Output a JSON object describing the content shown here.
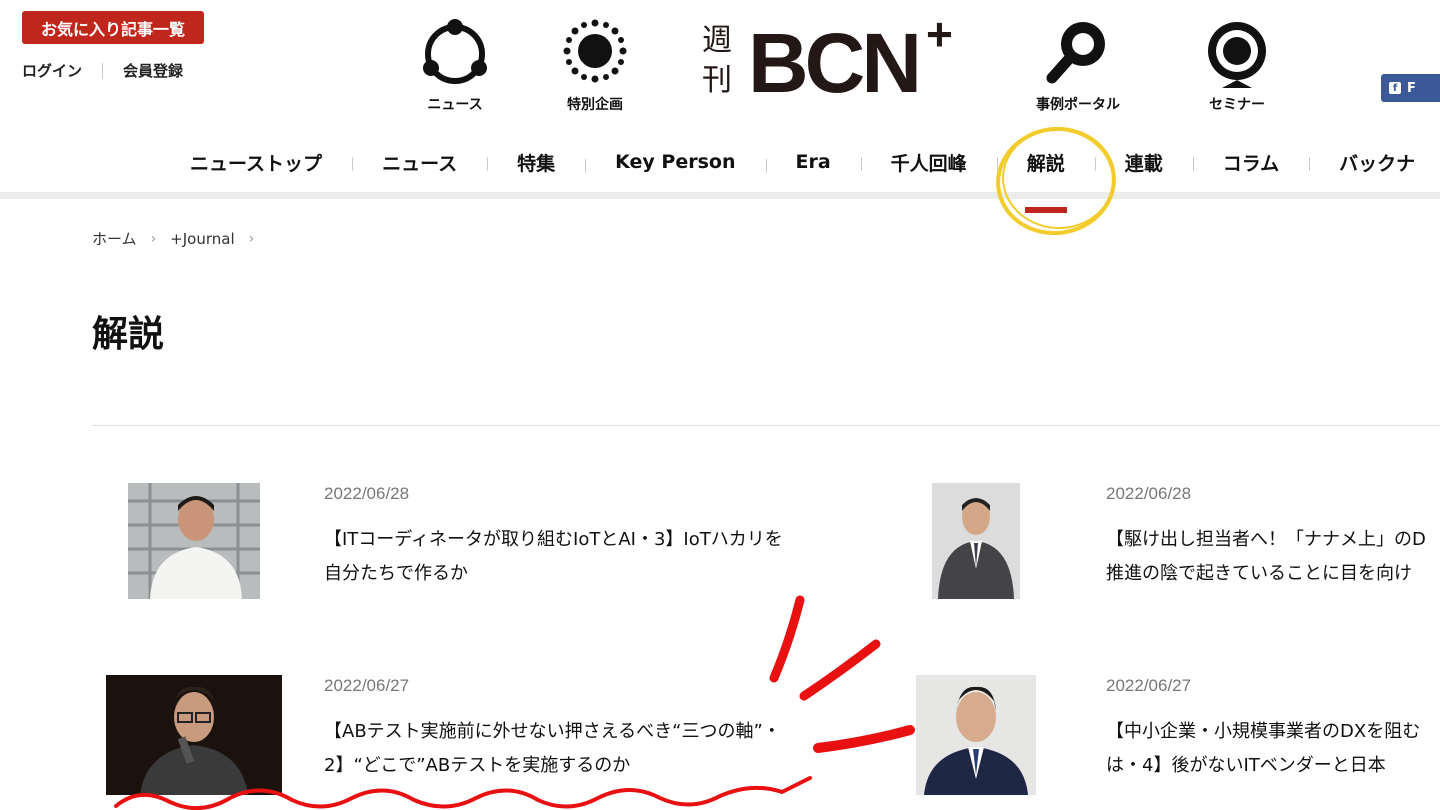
{
  "header": {
    "favorites_label": "お気に入り記事一覧",
    "login_label": "ログイン",
    "register_label": "会員登録",
    "icons": [
      {
        "name": "news",
        "label": "ニュース"
      },
      {
        "name": "special",
        "label": "特別企画"
      },
      {
        "name": "case-portal",
        "label": "事例ポータル"
      },
      {
        "name": "seminar",
        "label": "セミナー"
      }
    ],
    "logo": {
      "small_text_1": "週",
      "small_text_2": "刊",
      "main_text": "BCN",
      "plus": "+"
    },
    "facebook_label": "F"
  },
  "nav": {
    "items": [
      "ニューストップ",
      "ニュース",
      "特集",
      "Key Person",
      "Era",
      "千人回峰",
      "解説",
      "連載",
      "コラム",
      "バックナ"
    ],
    "active_index": 6
  },
  "breadcrumb": {
    "home": "ホーム",
    "current": "+Journal",
    "separator": "›"
  },
  "page": {
    "title": "解説"
  },
  "articles": [
    {
      "date": "2022/06/28",
      "line1": "【ITコーディネータが取り組むIoTとAI・3】IoTハカリを",
      "line2": "自分たちで作るか"
    },
    {
      "date": "2022/06/28",
      "line1": "【駆け出し担当者へ！「ナナメ上」のD",
      "line2": "推進の陰で起きていることに目を向け"
    },
    {
      "date": "2022/06/27",
      "line1": "【ABテスト実施前に外せない押さえるべき“三つの軸”・",
      "line2": "2】“どこで”ABテストを実施するのか"
    },
    {
      "date": "2022/06/27",
      "line1": "【中小企業・小規模事業者のDXを阻む",
      "line2": "は・4】後がないITベンダーと日本"
    }
  ],
  "colors": {
    "brand_red": "#c0271c",
    "highlight_yellow": "#f2cc2c",
    "annotation_red": "#e81010",
    "facebook_blue": "#3b5998"
  }
}
